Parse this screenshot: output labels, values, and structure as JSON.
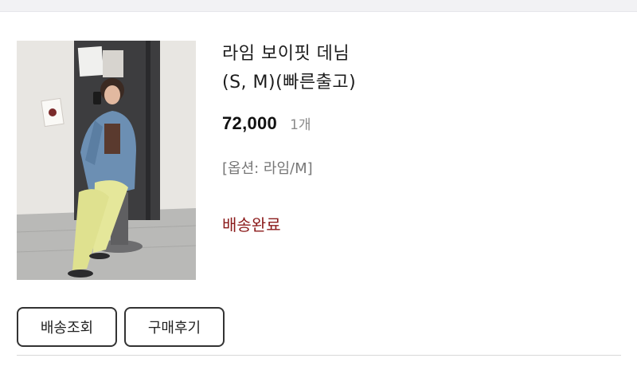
{
  "order": {
    "product_name_line1": "라임 보이핏 데님",
    "product_name_line2": "(S, M)(빠른출고)",
    "price": "72,000",
    "quantity": "1개",
    "option": "[옵션: 라임/M]",
    "status": "배송완료",
    "status_color": "#8b1a1a"
  },
  "actions": {
    "track_label": "배송조회",
    "review_label": "구매후기"
  },
  "thumbnail": {
    "icon": "product-photo-icon",
    "subject": "model-in-lime-jeans-and-denim-jacket"
  }
}
